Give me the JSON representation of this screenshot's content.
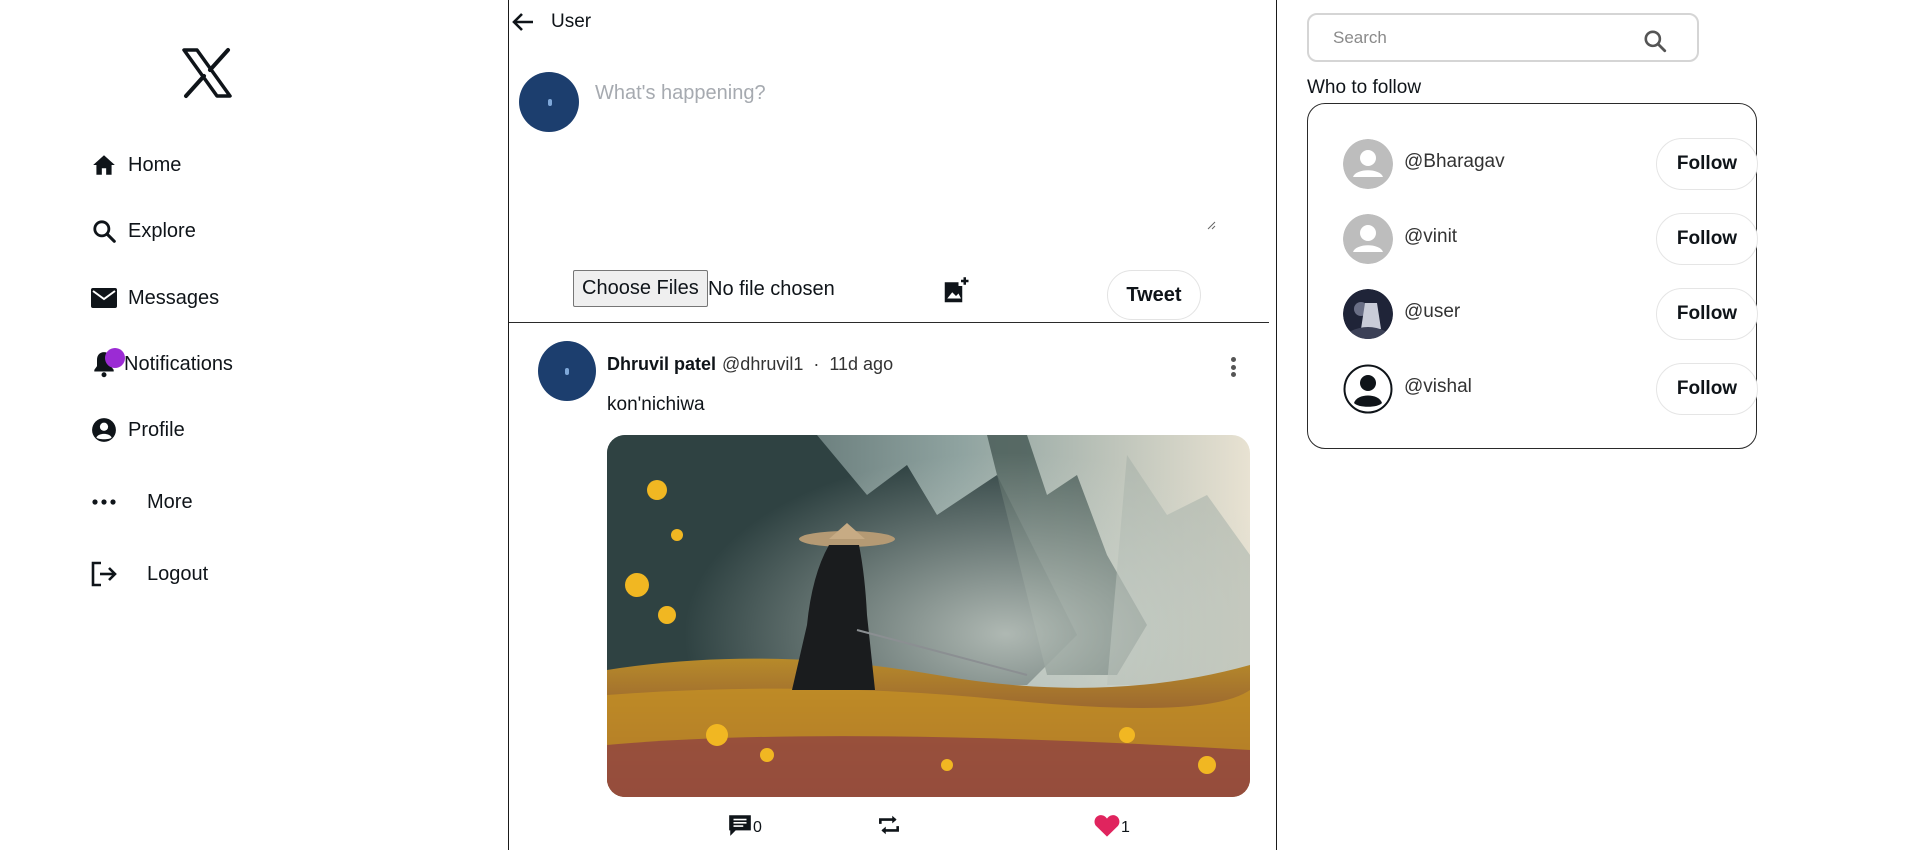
{
  "header": {
    "title": "User"
  },
  "sidebar": {
    "items": [
      {
        "label": "Home",
        "icon": "home-icon"
      },
      {
        "label": "Explore",
        "icon": "search-icon"
      },
      {
        "label": "Messages",
        "icon": "mail-icon"
      },
      {
        "label": "Notifications",
        "icon": "bell-icon"
      },
      {
        "label": "Profile",
        "icon": "account-circle-icon"
      },
      {
        "label": "More",
        "icon": "more-horizontal-icon"
      },
      {
        "label": "Logout",
        "icon": "logout-icon"
      }
    ]
  },
  "composer": {
    "placeholder": "What's happening?",
    "file_button": "Choose Files",
    "file_status": "No file chosen",
    "tweet_button": "Tweet"
  },
  "post": {
    "author": "Dhruvil patel",
    "handle": "@dhruvil1",
    "separator": "·",
    "time": "11d ago",
    "text": "kon'nichiwa",
    "comments": "0",
    "likes": "1"
  },
  "search": {
    "placeholder": "Search"
  },
  "who_to_follow": {
    "title": "Who to follow",
    "users": [
      {
        "handle": "@Bharagav",
        "button": "Follow"
      },
      {
        "handle": "@vinit",
        "button": "Follow"
      },
      {
        "handle": "@user",
        "button": "Follow"
      },
      {
        "handle": "@vishal",
        "button": "Follow"
      }
    ]
  },
  "colors": {
    "notification_dot": "#9b2bd4",
    "avatar_blue": "#1c3e6e",
    "like_red": "#e0245e"
  }
}
